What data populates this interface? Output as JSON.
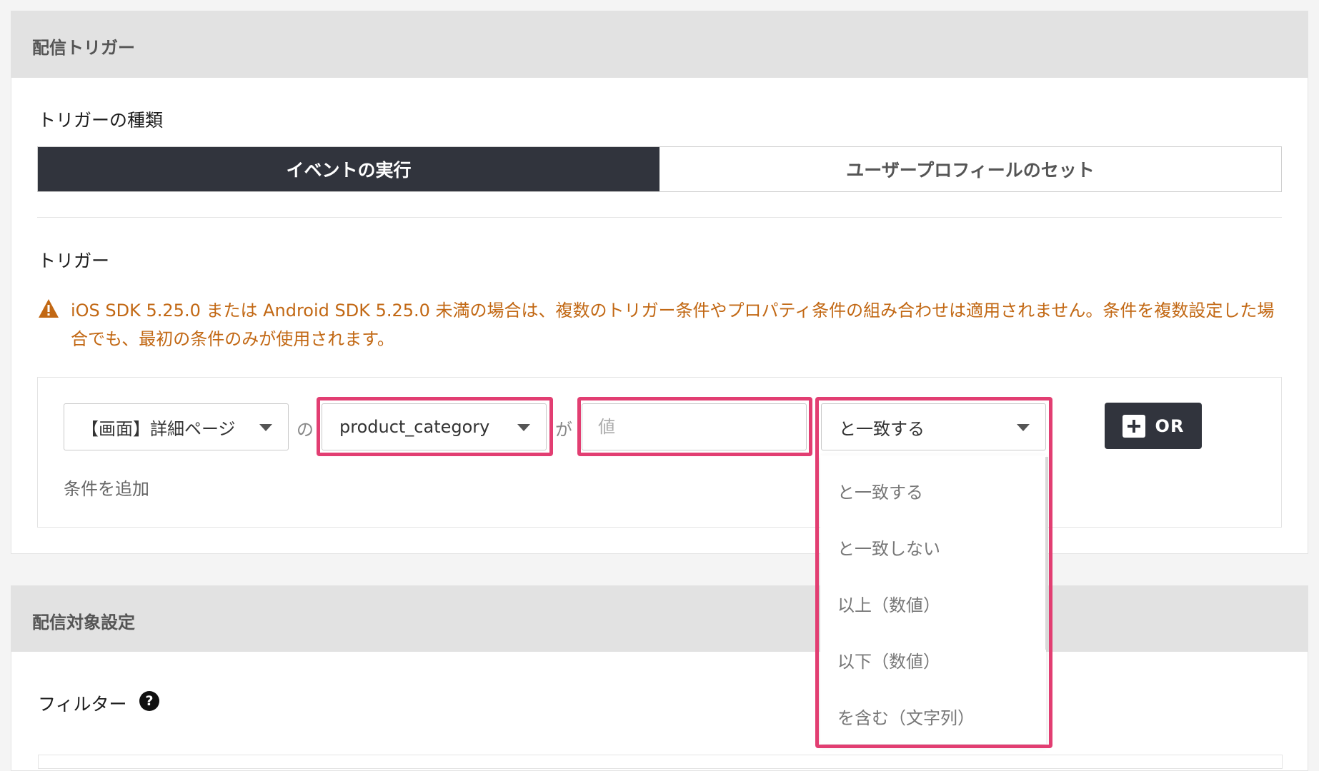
{
  "delivery_trigger": {
    "title": "配信トリガー",
    "trigger_type_label": "トリガーの種類",
    "trigger_types": [
      "イベントの実行",
      "ユーザープロフィールのセット"
    ],
    "trigger_label": "トリガー",
    "warning_text": "iOS SDK 5.25.0 または Android SDK 5.25.0 未満の場合は、複数のトリガー条件やプロパティ条件の組み合わせは適用されません。条件を複数設定した場合でも、最初の条件のみが使用されます。",
    "condition": {
      "event_select": "【画面】詳細ページ",
      "joiner_no": "の",
      "property_select": "product_category",
      "joiner_ga": "が",
      "value_placeholder": "値",
      "operator_select": "と一致する"
    },
    "or_button": "OR",
    "add_condition": "条件を追加"
  },
  "operator_options": [
    "と一致する",
    "と一致しない",
    "以上（数値）",
    "以下（数値）",
    "を含む（文字列）"
  ],
  "delivery_target": {
    "title": "配信対象設定",
    "filter_label": "フィルター",
    "help_glyph": "?"
  },
  "colors": {
    "accent_highlight": "#e23e72",
    "dark": "#31343d",
    "warning": "#c26814"
  }
}
